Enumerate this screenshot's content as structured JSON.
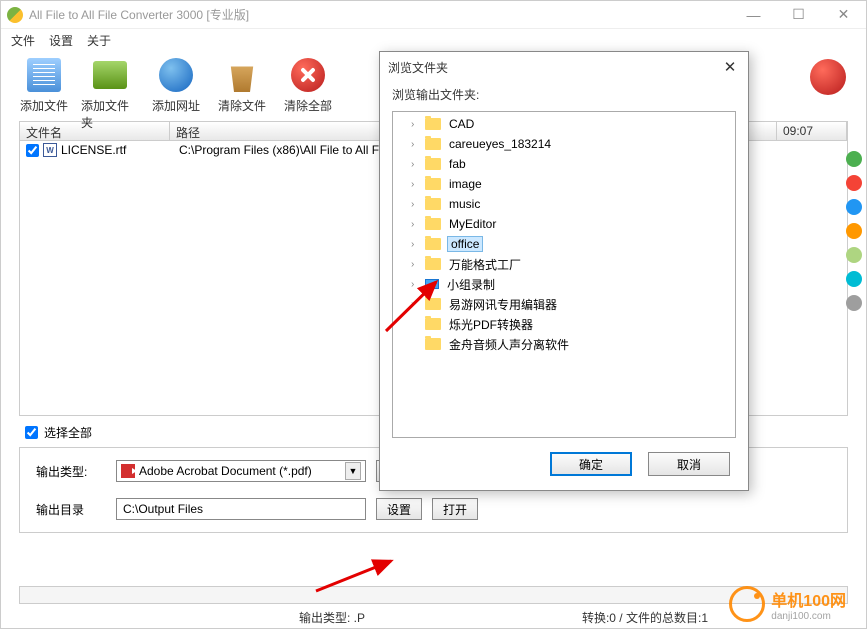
{
  "window": {
    "title": "All File to All File Converter 3000 [专业版]"
  },
  "menu": {
    "file": "文件",
    "settings": "设置",
    "about": "关于"
  },
  "toolbar": {
    "add_file": "添加文件",
    "add_folder": "添加文件夹",
    "add_url": "添加网址",
    "clear_file": "清除文件",
    "clear_all": "清除全部"
  },
  "columns": {
    "name": "文件名",
    "path": "路径",
    "time": "09:07"
  },
  "files": [
    {
      "name": "LICENSE.rtf",
      "path": "C:\\Program Files (x86)\\All File to All File C"
    }
  ],
  "select_all": "选择全部",
  "form": {
    "output_type_label": "输出类型:",
    "output_type_value": "Adobe Acrobat Document (*.pdf)",
    "settings_btn": "设置",
    "output_dir_label": "输出目录",
    "output_dir_value": "C:\\Output Files",
    "open_btn": "打开"
  },
  "status": {
    "convert": "转换:0 / 文件的总数目:1",
    "output_type": "输出类型: .P"
  },
  "dialog": {
    "title": "浏览文件夹",
    "subtitle": "浏览输出文件夹:",
    "items": [
      {
        "label": "CAD",
        "icon": "folder",
        "expandable": true
      },
      {
        "label": "careueyes_183214",
        "icon": "folder",
        "expandable": true
      },
      {
        "label": "fab",
        "icon": "folder",
        "expandable": true
      },
      {
        "label": "image",
        "icon": "folder",
        "expandable": true
      },
      {
        "label": "music",
        "icon": "folder",
        "expandable": true
      },
      {
        "label": "MyEditor",
        "icon": "folder",
        "expandable": true
      },
      {
        "label": "office",
        "icon": "folder",
        "expandable": true,
        "selected": true
      },
      {
        "label": "万能格式工厂",
        "icon": "folder",
        "expandable": true
      },
      {
        "label": "小组录制",
        "icon": "monitor",
        "expandable": true
      },
      {
        "label": "易游网讯专用编辑器",
        "icon": "folder",
        "expandable": true
      },
      {
        "label": "烁光PDF转换器",
        "icon": "folder",
        "expandable": false
      },
      {
        "label": "金舟音频人声分离软件",
        "icon": "folder",
        "expandable": false
      }
    ],
    "ok": "确定",
    "cancel": "取消"
  },
  "watermark": {
    "brand": "单机100网",
    "url": "danji100.com"
  }
}
